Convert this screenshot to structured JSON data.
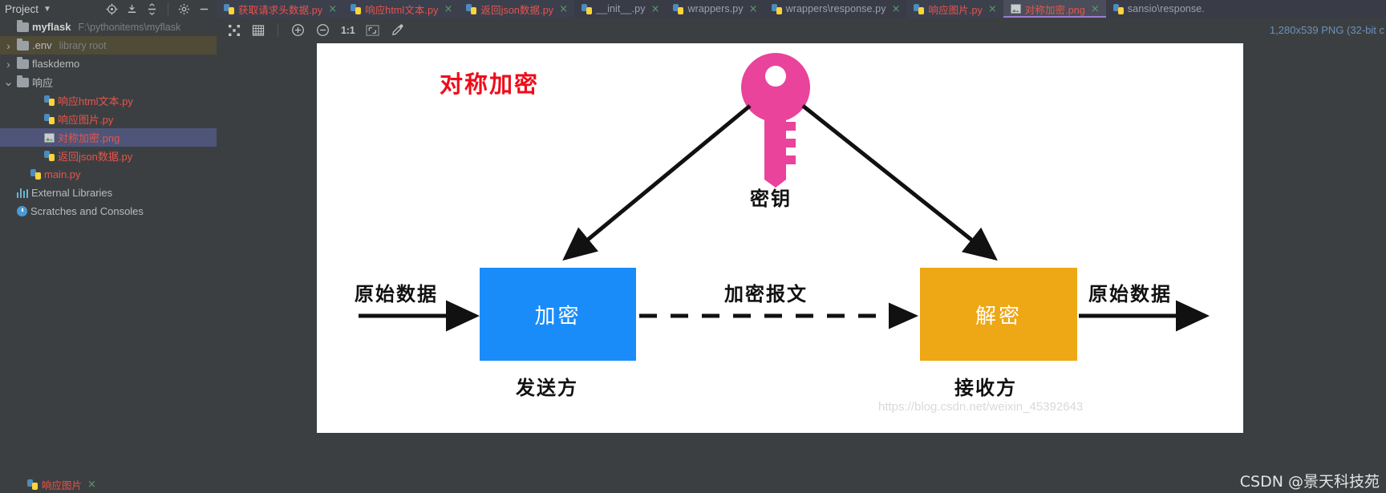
{
  "project_panel": {
    "title": "Project",
    "icons": [
      "chevron-down-icon",
      "locate-icon",
      "collapse-icon",
      "expand-icon",
      "gear-icon",
      "minimize-icon"
    ],
    "tree": [
      {
        "name": "myflask",
        "path": "F:\\pythonitems\\myflask",
        "icon": "folder-icon",
        "indent": 1,
        "arrow": "",
        "style": "bold",
        "state": "normal"
      },
      {
        "name": ".env",
        "path": "library root",
        "icon": "folder-icon",
        "indent": 1,
        "arrow": "›",
        "style": "grey",
        "state": "olive"
      },
      {
        "name": "flaskdemo",
        "path": "",
        "icon": "folder-icon",
        "indent": 1,
        "arrow": "›",
        "style": "grey",
        "state": "normal"
      },
      {
        "name": "响应",
        "path": "",
        "icon": "folder-icon",
        "indent": 1,
        "arrow": "∨",
        "style": "grey",
        "state": "normal"
      },
      {
        "name": "响应html文本.py",
        "path": "",
        "icon": "python-file-icon",
        "indent": 3,
        "arrow": "",
        "style": "red",
        "state": "normal"
      },
      {
        "name": "响应图片.py",
        "path": "",
        "icon": "python-file-icon",
        "indent": 3,
        "arrow": "",
        "style": "red",
        "state": "normal"
      },
      {
        "name": "对称加密.png",
        "path": "",
        "icon": "image-file-icon",
        "indent": 3,
        "arrow": "",
        "style": "red",
        "state": "selected"
      },
      {
        "name": "返回json数据.py",
        "path": "",
        "icon": "python-file-icon",
        "indent": 3,
        "arrow": "",
        "style": "red",
        "state": "normal"
      },
      {
        "name": "main.py",
        "path": "",
        "icon": "python-file-icon",
        "indent": 2,
        "arrow": "",
        "style": "red",
        "state": "normal"
      },
      {
        "name": "External Libraries",
        "path": "",
        "icon": "libraries-icon",
        "indent": 1,
        "arrow": "",
        "style": "grey",
        "state": "normal"
      },
      {
        "name": "Scratches and Consoles",
        "path": "",
        "icon": "scratches-icon",
        "indent": 1,
        "arrow": "",
        "style": "grey",
        "state": "normal"
      }
    ]
  },
  "tabs": [
    {
      "label": "获取请求头数据.py",
      "icon": "python-file-icon",
      "color": "red",
      "state": "inactive-dark",
      "close": "×"
    },
    {
      "label": "响应html文本.py",
      "icon": "python-file-icon",
      "color": "red",
      "state": "inactive-dark",
      "close": "×"
    },
    {
      "label": "返回json数据.py",
      "icon": "python-file-icon",
      "color": "red",
      "state": "inactive-dark",
      "close": "×"
    },
    {
      "label": "__init__.py",
      "icon": "python-file-icon",
      "color": "grey",
      "state": "normal",
      "close": "×"
    },
    {
      "label": "wrappers.py",
      "icon": "python-file-icon",
      "color": "grey",
      "state": "normal",
      "close": "×"
    },
    {
      "label": "wrappers\\response.py",
      "icon": "python-file-icon",
      "color": "grey",
      "state": "normal",
      "close": "×"
    },
    {
      "label": "响应图片.py",
      "icon": "python-file-icon",
      "color": "red",
      "state": "inactive-dark",
      "close": "×"
    },
    {
      "label": "对称加密.png",
      "icon": "image-file-icon",
      "color": "red",
      "state": "active",
      "close": "×"
    },
    {
      "label": "sansio\\response.",
      "icon": "python-file-icon",
      "color": "grey",
      "state": "normal",
      "close": ""
    }
  ],
  "toolbar": {
    "icons": [
      "fit-content-icon",
      "toggle-grid-icon",
      "zoom-in-icon",
      "zoom-out-icon",
      "actual-size-icon",
      "fit-window-icon",
      "color-picker-icon"
    ],
    "actual_size_label": "1:1",
    "image_info": "1,280x539 PNG (32-bit c"
  },
  "bottom_bar": {
    "tab_label": "响应图片",
    "close": "×",
    "icon": "python-file-icon"
  },
  "image": {
    "title": "对称加密",
    "title_color": "#ee0d1b",
    "key_label": "密钥",
    "key_color": "#e9439b",
    "encrypt_box": {
      "label": "加密",
      "color": "#1a8cfa"
    },
    "decrypt_box": {
      "label": "解密",
      "color": "#eea715"
    },
    "left_data_label": "原始数据",
    "cipher_label": "加密报文",
    "right_data_label": "原始数据",
    "sender_label": "发送方",
    "receiver_label": "接收方",
    "watermark_url": "https://blog.csdn.net/weixin_45392643",
    "watermark_author": "CSDN @景天科技苑"
  }
}
